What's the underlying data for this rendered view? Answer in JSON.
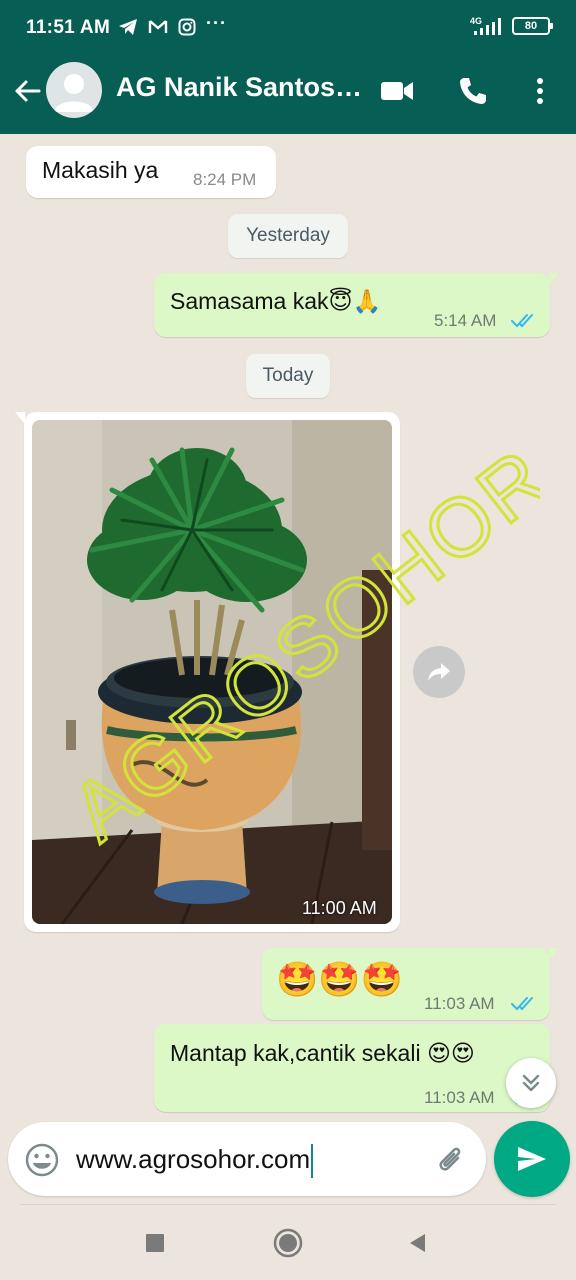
{
  "status_bar": {
    "time": "11:51 AM",
    "network": "4G",
    "battery": "80",
    "more": "···"
  },
  "header": {
    "contact_name": "AG Nanik Santos…"
  },
  "messages": [
    {
      "direction": "in",
      "text": "Makasih ya",
      "time": "8:24 PM"
    },
    {
      "type": "date",
      "label": "Yesterday"
    },
    {
      "direction": "out",
      "text": "Samasama kak😇🙏",
      "time": "5:14 AM",
      "status": "read"
    },
    {
      "type": "date",
      "label": "Today"
    },
    {
      "direction": "in",
      "type": "image",
      "time": "11:00 AM",
      "watermark": "AGROSOHOR"
    },
    {
      "direction": "out",
      "text": "🤩🤩🤩",
      "time": "11:03 AM",
      "status": "read"
    },
    {
      "direction": "out",
      "text": "Mantap kak,cantik sekali 😍😍",
      "time": "11:03 AM",
      "status": "read"
    }
  ],
  "composer": {
    "value": "www.agrosohor.com"
  },
  "colors": {
    "header": "#075E54",
    "chat_bg": "#ECE5DD",
    "outgoing": "#DCF8C6",
    "incoming": "#FFFFFF",
    "send": "#00A884",
    "read_ticks": "#34B7F1"
  }
}
